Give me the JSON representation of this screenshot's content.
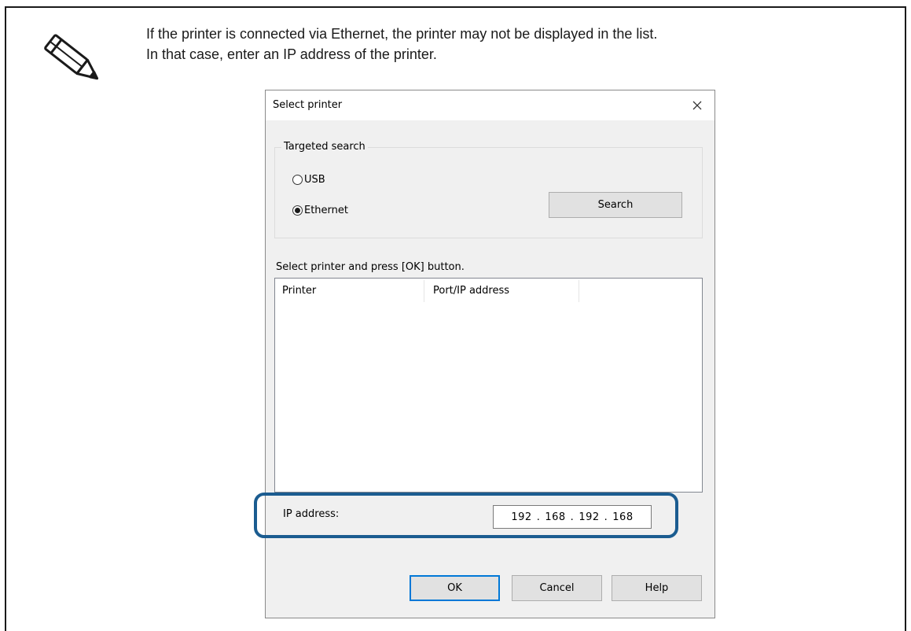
{
  "note": {
    "line1": "If the printer is connected via Ethernet, the printer may not be displayed in the list.",
    "line2": "In that case, enter an IP address of the printer."
  },
  "dialog": {
    "title": "Select printer",
    "targeted_search": {
      "legend": "Targeted search",
      "options": [
        {
          "label": "USB",
          "checked": false
        },
        {
          "label": "Ethernet",
          "checked": true
        }
      ],
      "search_label": "Search"
    },
    "list_instruction": "Select printer and press [OK] button.",
    "columns": [
      "Printer",
      "Port/IP address"
    ],
    "ip_label": "IP address:",
    "ip_octets": [
      "192",
      "168",
      "192",
      "168"
    ],
    "ip_separator": ".",
    "buttons": {
      "ok": "OK",
      "cancel": "Cancel",
      "help": "Help"
    }
  },
  "colors": {
    "highlight": "#1b5c90",
    "default_button_border": "#0078d7"
  },
  "icons": {
    "note": "pencil-icon",
    "close": "close-icon"
  }
}
